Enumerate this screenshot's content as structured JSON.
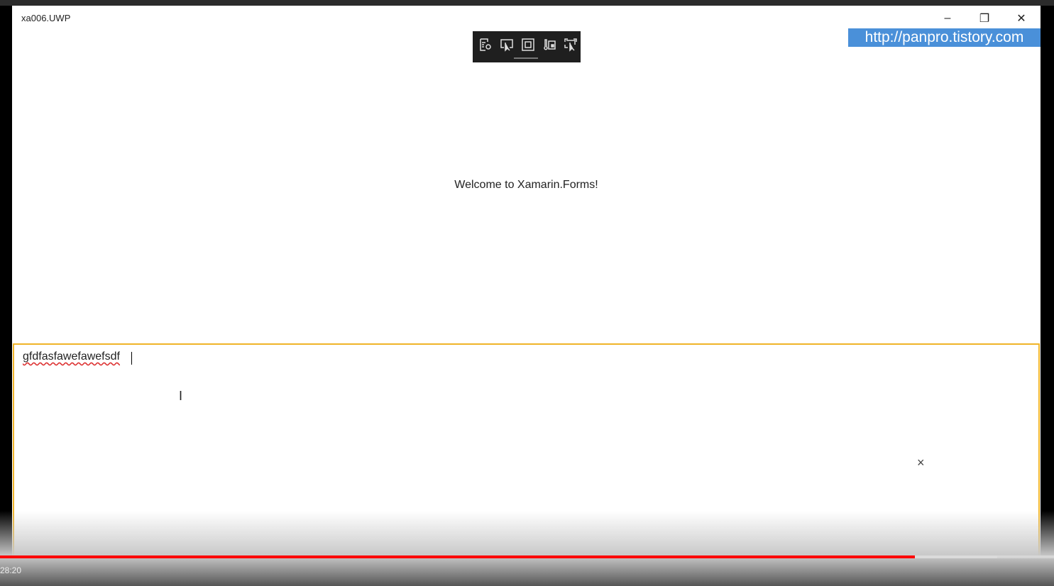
{
  "window": {
    "title": "xa006.UWP",
    "minimize": "–",
    "restore": "❐",
    "close": "✕"
  },
  "watermark": "http://panpro.tistory.com",
  "debug_toolbar": {
    "icons": [
      "live-visual-tree-icon",
      "select-element-icon",
      "display-layout-adorners-icon",
      "track-focus-icon",
      "preview-selection-icon"
    ]
  },
  "main": {
    "welcome": "Welcome to Xamarin.Forms!"
  },
  "editor": {
    "value": "gfdfasfawefawefsdf",
    "dismiss": "×"
  },
  "video": {
    "time": "28:20",
    "played_fraction": 0.868,
    "buffered_fraction": 0.946,
    "accent": "#ff0000"
  }
}
